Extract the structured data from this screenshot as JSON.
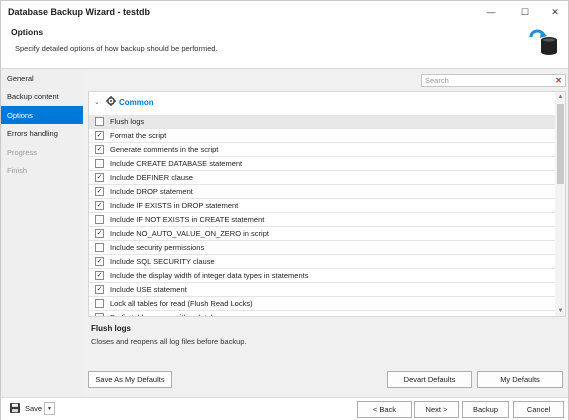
{
  "window": {
    "title": "Database Backup Wizard - testdb",
    "minimize": "—",
    "maximize": "☐",
    "close": "✕"
  },
  "header": {
    "title": "Options",
    "subtitle": "Specify detailed options of how backup should be performed."
  },
  "sidebar": {
    "items": [
      {
        "label": "General",
        "state": "normal"
      },
      {
        "label": "Backup content",
        "state": "normal"
      },
      {
        "label": "Options",
        "state": "active"
      },
      {
        "label": "Errors handling",
        "state": "normal"
      },
      {
        "label": "Progress",
        "state": "disabled"
      },
      {
        "label": "Finish",
        "state": "disabled"
      }
    ]
  },
  "search": {
    "placeholder": "Search",
    "clear": "✕"
  },
  "category": {
    "label": "Common"
  },
  "options": [
    {
      "label": "Flush logs",
      "checked": false
    },
    {
      "label": "Format the script",
      "checked": true
    },
    {
      "label": "Generate comments in the script",
      "checked": true
    },
    {
      "label": "Include CREATE DATABASE statement",
      "checked": false
    },
    {
      "label": "Include DEFINER clause",
      "checked": true
    },
    {
      "label": "Include DROP statement",
      "checked": true
    },
    {
      "label": "Include IF EXISTS in DROP statement",
      "checked": true
    },
    {
      "label": "Include IF NOT EXISTS in CREATE statement",
      "checked": false
    },
    {
      "label": "Include NO_AUTO_VALUE_ON_ZERO in script",
      "checked": true
    },
    {
      "label": "Include security permissions",
      "checked": false
    },
    {
      "label": "Include SQL SECURITY clause",
      "checked": true
    },
    {
      "label": "Include the display width of integer data types in statements",
      "checked": true
    },
    {
      "label": "Include USE statement",
      "checked": true
    },
    {
      "label": "Lock all tables for read (Flush Read Locks)",
      "checked": false
    },
    {
      "label": "Prefix table names with a database name",
      "checked": false
    }
  ],
  "description": {
    "title": "Flush logs",
    "text": "Closes and reopens all log files before backup."
  },
  "buttons": {
    "save_as_defaults": "Save As My Defaults",
    "devart_defaults": "Devart Defaults",
    "my_defaults": "My Defaults",
    "save": "Save",
    "back": "< Back",
    "next": "Next >",
    "backup": "Backup",
    "cancel": "Cancel"
  },
  "colors": {
    "accent": "#0078d7",
    "sidebar_bg": "#efefef",
    "panel_bg": "#f0f0f0"
  }
}
